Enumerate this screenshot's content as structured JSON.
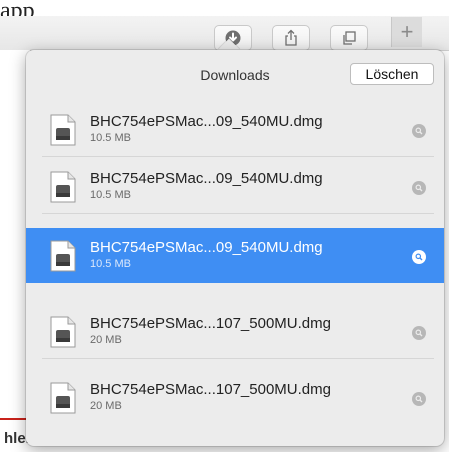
{
  "background": {
    "top_text": "app",
    "bottom_text": "hlen."
  },
  "toolbar": {
    "buttons": [
      {
        "icon": "download-icon"
      },
      {
        "icon": "share-icon"
      },
      {
        "icon": "tabs-icon"
      }
    ],
    "new_tab_label": "+"
  },
  "downloads": {
    "title": "Downloads",
    "clear_label": "Löschen",
    "items": [
      {
        "name": "BHC754ePSMac...09_540MU.dmg",
        "size": "10.5 MB",
        "selected": false
      },
      {
        "name": "BHC754ePSMac...09_540MU.dmg",
        "size": "10.5 MB",
        "selected": false
      },
      {
        "name": "BHC754ePSMac...09_540MU.dmg",
        "size": "10.5 MB",
        "selected": true
      },
      {
        "name": "BHC754ePSMac...107_500MU.dmg",
        "size": "20 MB",
        "selected": false
      },
      {
        "name": "BHC754ePSMac...107_500MU.dmg",
        "size": "20 MB",
        "selected": false
      }
    ]
  },
  "colors": {
    "selection": "#3f8ef3",
    "accent_red": "#c9221b"
  }
}
